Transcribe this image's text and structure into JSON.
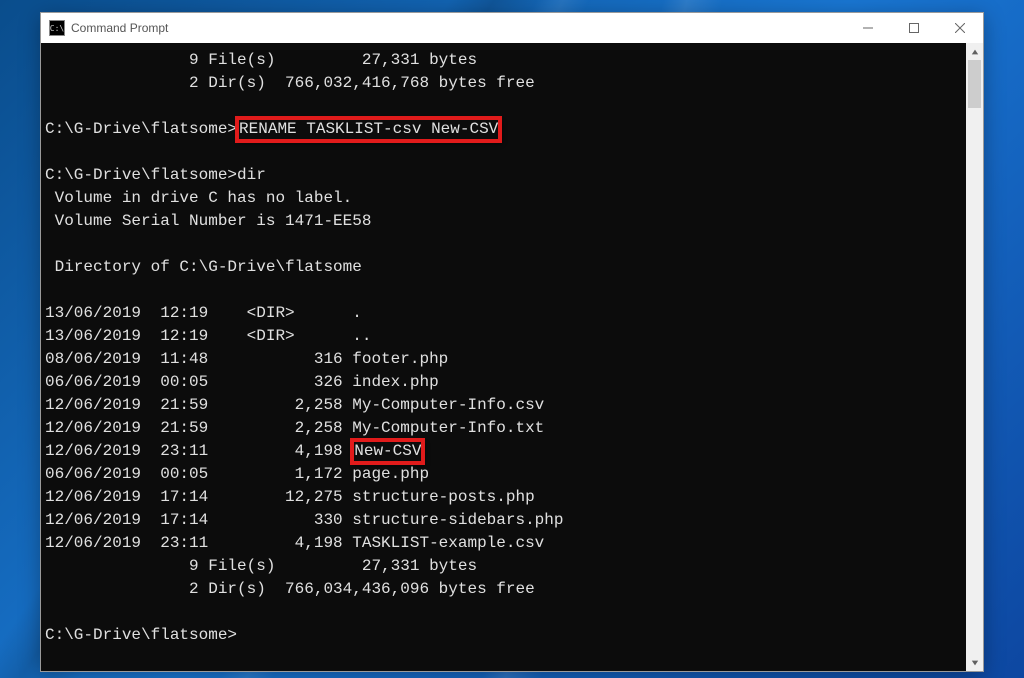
{
  "window": {
    "title": "Command Prompt",
    "icon_text": "C:\\"
  },
  "summary_top": {
    "files_line": "               9 File(s)         27,331 bytes",
    "dirs_line": "               2 Dir(s)  766,032,416,768 bytes free"
  },
  "prompt_path": "C:\\G-Drive\\flatsome>",
  "rename_cmd": "RENAME TASKLIST-csv New-CSV",
  "dir_cmd": "dir",
  "volume_line1": " Volume in drive C has no label.",
  "volume_line2": " Volume Serial Number is 1471-EE58",
  "dir_of": " Directory of C:\\G-Drive\\flatsome",
  "listing": [
    {
      "date": "13/06/2019",
      "time": "12:19",
      "size": "<DIR>     ",
      "name": "."
    },
    {
      "date": "13/06/2019",
      "time": "12:19",
      "size": "<DIR>     ",
      "name": ".."
    },
    {
      "date": "08/06/2019",
      "time": "11:48",
      "size": "       316",
      "name": "footer.php"
    },
    {
      "date": "06/06/2019",
      "time": "00:05",
      "size": "       326",
      "name": "index.php"
    },
    {
      "date": "12/06/2019",
      "time": "21:59",
      "size": "     2,258",
      "name": "My-Computer-Info.csv"
    },
    {
      "date": "12/06/2019",
      "time": "21:59",
      "size": "     2,258",
      "name": "My-Computer-Info.txt"
    },
    {
      "date": "12/06/2019",
      "time": "23:11",
      "size": "     4,198",
      "name": "New-CSV",
      "highlight": true
    },
    {
      "date": "06/06/2019",
      "time": "00:05",
      "size": "     1,172",
      "name": "page.php"
    },
    {
      "date": "12/06/2019",
      "time": "17:14",
      "size": "    12,275",
      "name": "structure-posts.php"
    },
    {
      "date": "12/06/2019",
      "time": "17:14",
      "size": "       330",
      "name": "structure-sidebars.php"
    },
    {
      "date": "12/06/2019",
      "time": "23:11",
      "size": "     4,198",
      "name": "TASKLIST-example.csv"
    }
  ],
  "summary_bottom": {
    "files_line": "               9 File(s)         27,331 bytes",
    "dirs_line": "               2 Dir(s)  766,034,436,096 bytes free"
  }
}
